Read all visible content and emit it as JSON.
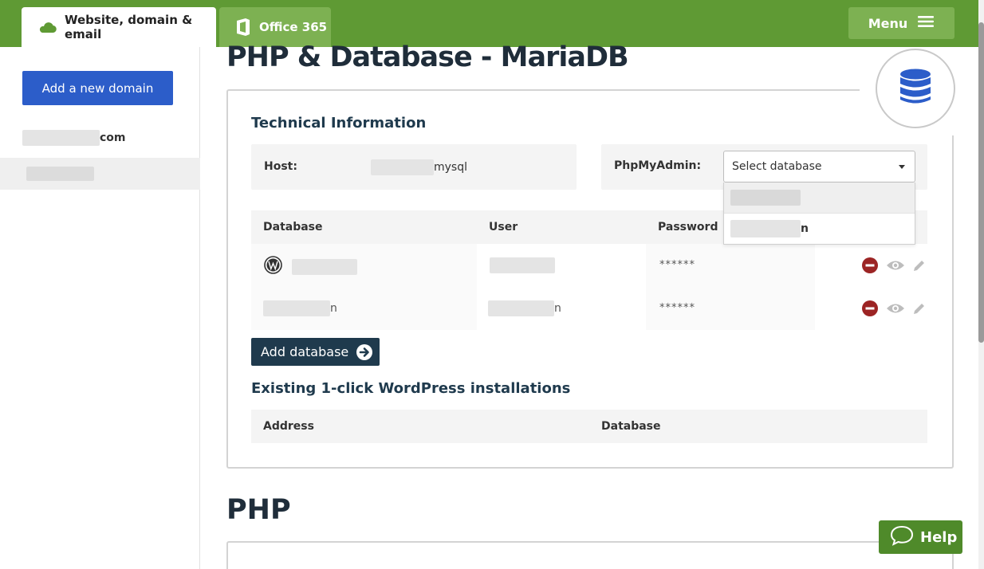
{
  "topbar": {
    "tabs": [
      {
        "label": "Website, domain & email",
        "icon": "cloud-icon",
        "active": true
      },
      {
        "label": "Office 365",
        "icon": "office-icon",
        "active": false
      }
    ],
    "menu_label": "Menu",
    "bg_color": "#5f9a34"
  },
  "sidebar": {
    "add_domain_label": "Add a new domain",
    "domains": [
      {
        "suffix": "com"
      },
      {
        "suffix": ""
      }
    ]
  },
  "main": {
    "page_title": "PHP & Database - MariaDB",
    "technical_title": "Technical Information",
    "host_label": "Host:",
    "host_value_suffix": "mysql",
    "phpmyadmin_label": "PhpMyAdmin:",
    "select_placeholder": "Select database",
    "dropdown_options": [
      {
        "suffix": ""
      },
      {
        "suffix": "n"
      }
    ],
    "db_table": {
      "headers": [
        "Database",
        "User",
        "Password"
      ],
      "rows": [
        {
          "database_suffix": "",
          "user_suffix": "",
          "password": "******",
          "has_wp_icon": true
        },
        {
          "database_suffix": "n",
          "user_suffix": "n",
          "password": "******",
          "has_wp_icon": false
        }
      ]
    },
    "add_database_label": "Add database",
    "wp_title": "Existing 1-click WordPress installations",
    "wp_table_headers": [
      "Address",
      "Database"
    ],
    "php_title": "PHP"
  },
  "help_label": "Help",
  "colors": {
    "primary_blue": "#2c5dc9",
    "dark_navy": "#1f3a4d",
    "green": "#5f9a34",
    "delete_red": "#9c2424"
  }
}
